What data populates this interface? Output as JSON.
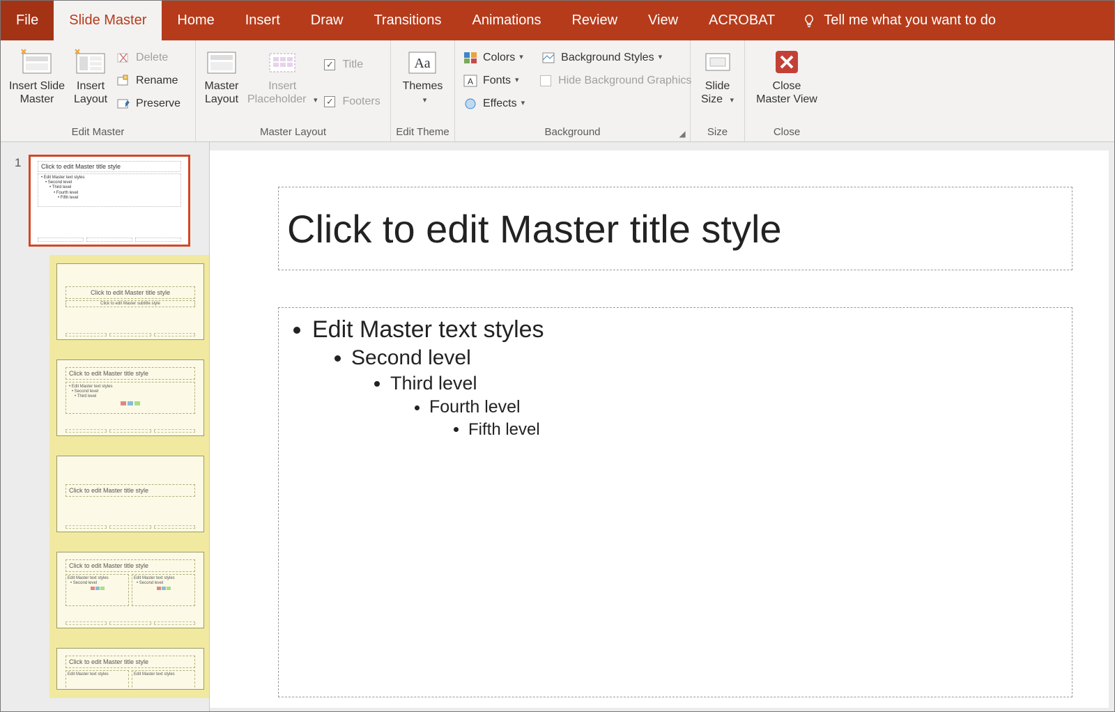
{
  "tabs": {
    "file": "File",
    "slide_master": "Slide Master",
    "home": "Home",
    "insert": "Insert",
    "draw": "Draw",
    "transitions": "Transitions",
    "animations": "Animations",
    "review": "Review",
    "view": "View",
    "acrobat": "ACROBAT"
  },
  "tellme_placeholder": "Tell me what you want to do",
  "ribbon": {
    "edit_master": {
      "label": "Edit Master",
      "insert_slide_master": "Insert Slide\nMaster",
      "insert_layout": "Insert\nLayout",
      "delete": "Delete",
      "rename": "Rename",
      "preserve": "Preserve"
    },
    "master_layout": {
      "label": "Master Layout",
      "master_layout_btn": "Master\nLayout",
      "insert_placeholder": "Insert\nPlaceholder",
      "title_chk": "Title",
      "footers_chk": "Footers"
    },
    "edit_theme": {
      "label": "Edit Theme",
      "themes": "Themes"
    },
    "background": {
      "label": "Background",
      "colors": "Colors",
      "fonts": "Fonts",
      "effects": "Effects",
      "bg_styles": "Background Styles",
      "hide_bg": "Hide Background Graphics"
    },
    "size": {
      "label": "Size",
      "slide_size": "Slide\nSize"
    },
    "close": {
      "label": "Close",
      "close_master": "Close\nMaster View"
    }
  },
  "sidebar": {
    "master_number": "1",
    "master_title": "Click to edit Master title style",
    "master_body_l1": "• Edit Master text styles",
    "master_body_l2": "• Second level",
    "master_body_l3": "• Third level",
    "master_body_l4": "• Fourth level",
    "master_body_l5": "• Fifth level",
    "layout_title": "Click to edit Master title style",
    "layout_two_col_hdr": "Edit Master text styles"
  },
  "canvas": {
    "title": "Click to edit Master title style",
    "level1": "Edit Master text styles",
    "level2": "Second level",
    "level3": "Third level",
    "level4": "Fourth level",
    "level5": "Fifth level"
  }
}
